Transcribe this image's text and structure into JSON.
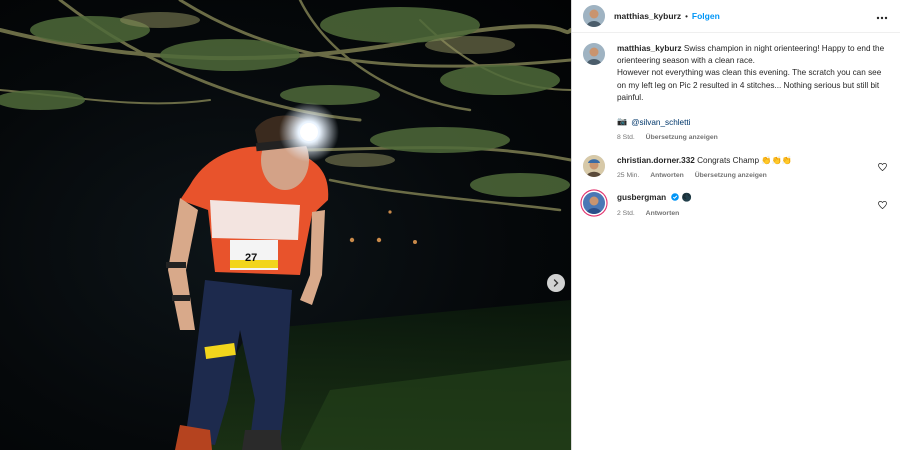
{
  "post": {
    "author": "matthias_kyburz",
    "separator": "•",
    "follow_label": "Folgen",
    "more_icon": "more-horizontal-icon"
  },
  "caption": {
    "author": "matthias_kyburz",
    "line1": "Swiss champion in night orienteering! Happy to end the orienteering season with a clean race.",
    "line2": "However not everything was clean this evening. The scratch you can see on my left leg on Pic 2 resulted in 4 stitches... Nothing serious but still bit painful.",
    "camera_emoji": "📷",
    "mention": "@silvan_schletti",
    "time": "8 Std.",
    "translate": "Übersetzung anzeigen"
  },
  "comments": [
    {
      "user": "christian.dorner.332",
      "text": "Congrats Champ 👏👏👏",
      "time": "25 Min.",
      "reply": "Antworten",
      "translate": "Übersetzung anzeigen"
    },
    {
      "user": "gusbergman",
      "text": "🌑",
      "time": "2 Std.",
      "reply": "Antworten",
      "verified": true
    }
  ],
  "photo": {
    "bib_number": "27",
    "carousel_next_icon": "chevron-right-icon"
  },
  "colors": {
    "link": "#0095f6",
    "mention": "#00376b",
    "muted": "#737373",
    "jersey": "#e8532c"
  }
}
